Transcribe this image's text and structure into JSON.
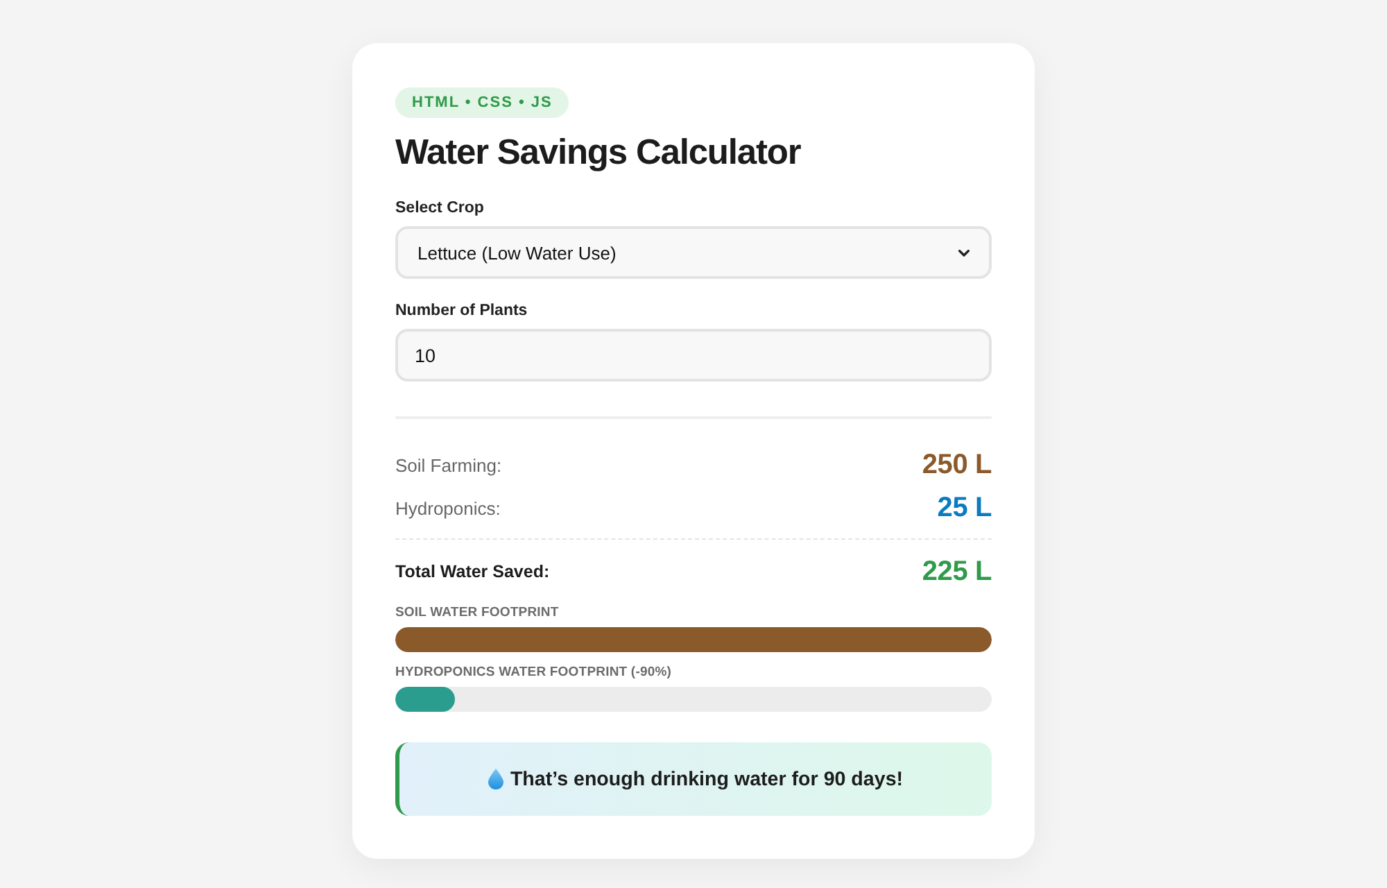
{
  "badge": "HTML • CSS • JS",
  "title": "Water Savings Calculator",
  "fields": [
    {
      "kind": "select",
      "label": "Select Crop",
      "value": "Lettuce (Low Water Use)"
    },
    {
      "kind": "input",
      "label": "Number of Plants",
      "value": "10"
    }
  ],
  "results": [
    {
      "kind": "normal",
      "label": "Soil Farming:",
      "value": "250 L",
      "color": "#8b5a2b"
    },
    {
      "kind": "normal",
      "label": "Hydroponics:",
      "value": "25 L",
      "color": "#0b7bc1"
    },
    {
      "kind": "total",
      "label": "Total Water Saved:",
      "value": "225 L",
      "color": "#2e9a4a"
    }
  ],
  "footprints": [
    {
      "label": "SOIL WATER FOOTPRINT",
      "level": 1,
      "color": "#8b5a2b"
    },
    {
      "label": "HYDROPONICS WATER FOOTPRINT (-90%)",
      "level": 0.1,
      "color": "#2a9d8f"
    }
  ],
  "message": "That’s enough drinking water for **90 days**!"
}
